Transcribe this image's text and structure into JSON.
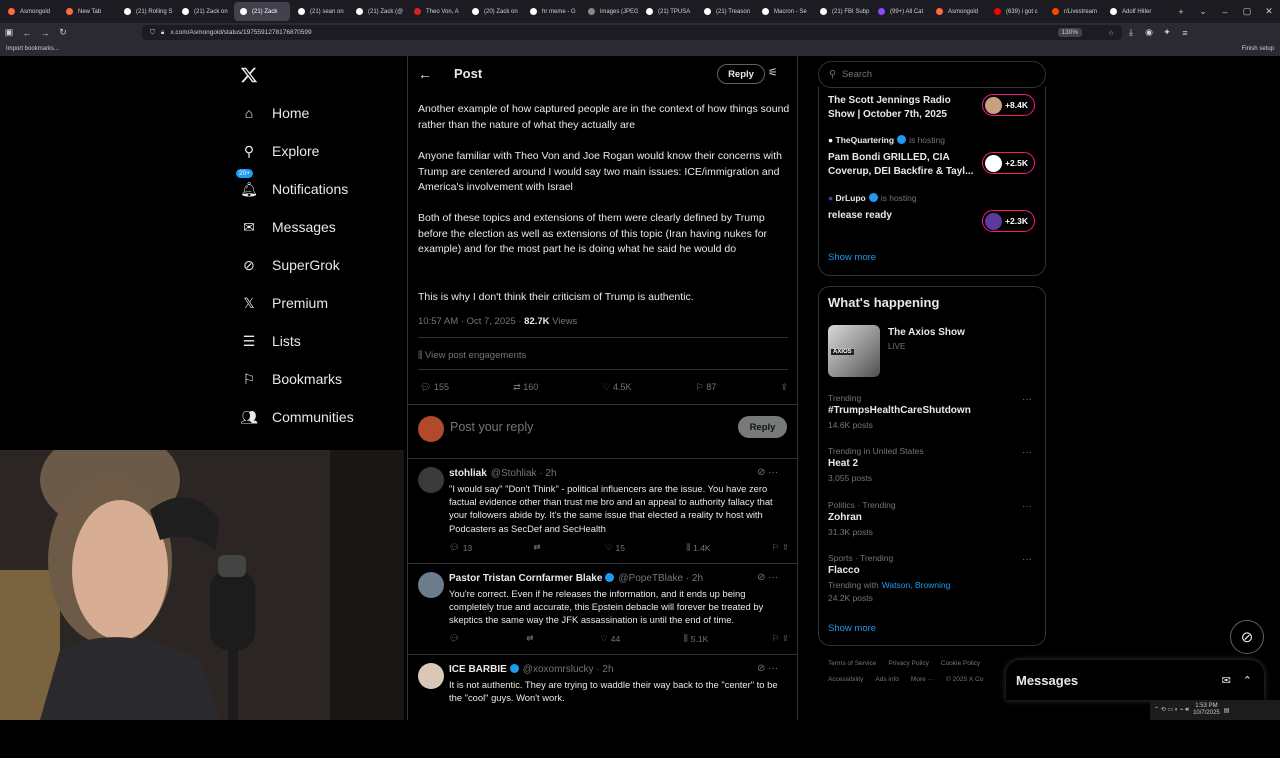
{
  "browser": {
    "tabs": [
      {
        "label": "Asmongold",
        "color": "#ff6b3d"
      },
      {
        "label": "New Tab",
        "color": "#ff6b3d"
      },
      {
        "label": "(21) Rolling S",
        "color": "#ffffff"
      },
      {
        "label": "(21) Zack on",
        "color": "#ffffff"
      },
      {
        "label": "(21) Zack",
        "color": "#ffffff"
      },
      {
        "label": "(21) sean on",
        "color": "#ffffff"
      },
      {
        "label": "(21) Zack (@",
        "color": "#ffffff"
      },
      {
        "label": "Theo Von, A",
        "color": "#e02020"
      },
      {
        "label": "(20) Zack on",
        "color": "#ffffff"
      },
      {
        "label": "hr meme - G",
        "color": "#ffffff"
      },
      {
        "label": "images (JPEG Im",
        "color": "#888888"
      },
      {
        "label": "(21) TPUSA",
        "color": "#ffffff"
      },
      {
        "label": "(21) Treason",
        "color": "#ffffff"
      },
      {
        "label": "Macron - Se",
        "color": "#ffffff"
      },
      {
        "label": "(21) FBI Subp",
        "color": "#ffffff"
      },
      {
        "label": "(99+) All Cat",
        "color": "#9146ff"
      },
      {
        "label": "Asmongold",
        "color": "#ff6b3d"
      },
      {
        "label": "(639) i got c",
        "color": "#ff0000"
      },
      {
        "label": "r/Livestream",
        "color": "#ff4500"
      },
      {
        "label": "Adolf Hitler",
        "color": "#ffffff"
      }
    ],
    "active_tab_index": 4,
    "url": "x.com/Asmongold/status/1975591278176870599",
    "zoom": "130%",
    "import_bookmarks": "Import bookmarks...",
    "finish_setup": "Finish setup"
  },
  "sidebar": {
    "items": [
      {
        "label": "Home",
        "icon": "home-icon"
      },
      {
        "label": "Explore",
        "icon": "search-icon"
      },
      {
        "label": "Notifications",
        "icon": "bell-icon",
        "badge": "20+"
      },
      {
        "label": "Messages",
        "icon": "mail-icon"
      },
      {
        "label": "SuperGrok",
        "icon": "grok-icon"
      },
      {
        "label": "Premium",
        "icon": "x-logo-icon"
      },
      {
        "label": "Lists",
        "icon": "list-icon"
      },
      {
        "label": "Bookmarks",
        "icon": "bookmark-icon"
      },
      {
        "label": "Communities",
        "icon": "communities-icon"
      }
    ]
  },
  "post": {
    "header_title": "Post",
    "reply_button": "Reply",
    "paragraphs": [
      "Another example of how captured people are in the context of how things sound rather than the nature of what they actually are",
      "Anyone familiar with Theo Von and Joe Rogan would know their concerns with Trump are centered around I would say two main issues: ICE/immigration and America's involvement with Israel",
      "Both of these topics and extensions of them were clearly defined by Trump before the election as well as extensions of this topic (Iran having nukes for example) and for the most part he is doing what he said he would do",
      "This is why I don't think their criticism of Trump is authentic."
    ],
    "timestamp": "10:57 AM · Oct 7, 2025 ·",
    "views_count": "82.7K",
    "views_label": "Views",
    "engagements": "View post engagements",
    "stats": {
      "replies": "155",
      "reposts": "160",
      "likes": "4.5K",
      "bookmarks": "87"
    },
    "reply_placeholder": "Post your reply",
    "reply_submit": "Reply"
  },
  "replies": [
    {
      "name": "stohliak",
      "handle": "@Stohliak · 2h",
      "text": "\"I would say\" \"Don't Think\" - political influencers are the issue.  You have zero factual evidence other than trust me bro and an appeal to authority fallacy that your followers abide by.  It's the same issue that elected a reality tv host with Podcasters as SecDef and SecHealth",
      "replies": "13",
      "reposts": "",
      "likes": "15",
      "views": "1.4K",
      "avatar_color": "#3a3a3a"
    },
    {
      "name": "Pastor Tristan Cornfarmer Blake",
      "handle": "@PopeTBlake · 2h",
      "text": "You're correct. Even if he releases the information, and it ends up being completely true and accurate, this Epstein debacle will forever be treated by skeptics the same way the JFK assassination is until the end of time.",
      "replies": "",
      "reposts": "",
      "likes": "44",
      "views": "5.1K",
      "avatar_color": "#6b7c8c"
    },
    {
      "name": "ICE BARBIE",
      "handle": "@xoxomrslucky · 2h",
      "text": "It is not authentic. They are trying to waddle their way back to the \"center\" to be the \"cool\" guys. Won't work.",
      "replies": "",
      "reposts": "",
      "likes": "",
      "views": "",
      "avatar_color": "#d9c8b8"
    }
  ],
  "right": {
    "search_placeholder": "Search",
    "spaces": [
      {
        "host": "",
        "title": "The Scott Jennings Radio Show | October 7th, 2025",
        "count": "+8.4K",
        "color": "#c8a080"
      },
      {
        "host": "TheQuartering",
        "hosting": "is hosting",
        "title": "Pam Bondi GRILLED,  CIA Coverup, DEI Backfire & Tayl...",
        "count": "+2.5K",
        "color": "#ffffff"
      },
      {
        "host": "DrLupo",
        "hosting": "is hosting",
        "title": "release ready",
        "count": "+2.3K",
        "color": "#5a3a9a"
      }
    ],
    "show_more_1": "Show more",
    "whats_happening": "What's happening",
    "axios_title": "The Axios Show",
    "axios_live": "LIVE",
    "trends": [
      {
        "meta": "Trending",
        "title": "#TrumpsHealthCareShutdown",
        "posts": "14.6K posts"
      },
      {
        "meta": "Trending in United States",
        "title": "Heat 2",
        "posts": "3,055 posts"
      },
      {
        "meta": "Politics · Trending",
        "title": "Zohran",
        "posts": "31.3K posts"
      },
      {
        "meta": "Sports · Trending",
        "title": "Flacco",
        "posts": "24.2K posts",
        "with": "Trending with",
        "with_names": "Watson, Browning"
      }
    ],
    "show_more_2": "Show more",
    "footer1": [
      "Terms of Service",
      "Privacy Policy",
      "Cookie Policy"
    ],
    "footer2": [
      "Accessibility",
      "Ads info",
      "More ···",
      "© 2025 X Co"
    ],
    "messages_drawer": "Messages"
  },
  "taskbar": {
    "time": "1:53 PM",
    "date": "10/7/2025"
  }
}
